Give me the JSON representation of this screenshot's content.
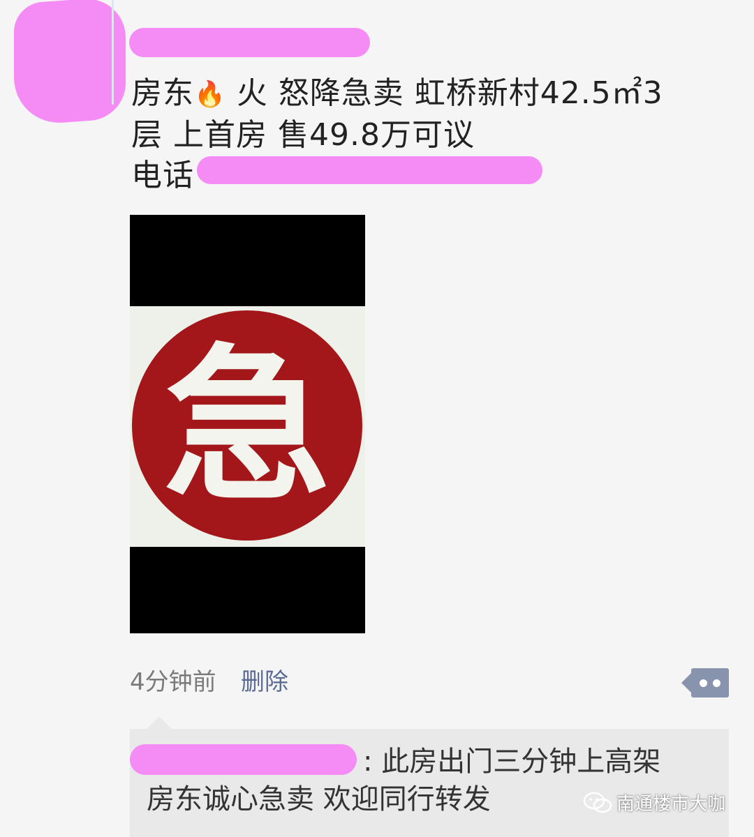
{
  "post": {
    "line1": "房东",
    "fire_emoji": "🔥",
    "line1_rest": " 火  怒降急卖   虹桥新村42.5㎡3",
    "line2": "层   上首房  售49.8万可议",
    "phone_label": "电话"
  },
  "image": {
    "seal_char": "急",
    "colors": {
      "seal": "#a3171a",
      "background": "#000000"
    }
  },
  "meta": {
    "time": "4分钟前",
    "delete": "删除"
  },
  "comment": {
    "line1": ": 此房出门三分钟上高架",
    "line2": "房东诚心急卖  欢迎同行转发"
  },
  "watermark": {
    "text": "南通楼市大咖",
    "icon": "wechat-icon"
  },
  "colors": {
    "redaction": "#f58cf5",
    "link": "#5b6b93",
    "more_button": "#8894ad"
  }
}
